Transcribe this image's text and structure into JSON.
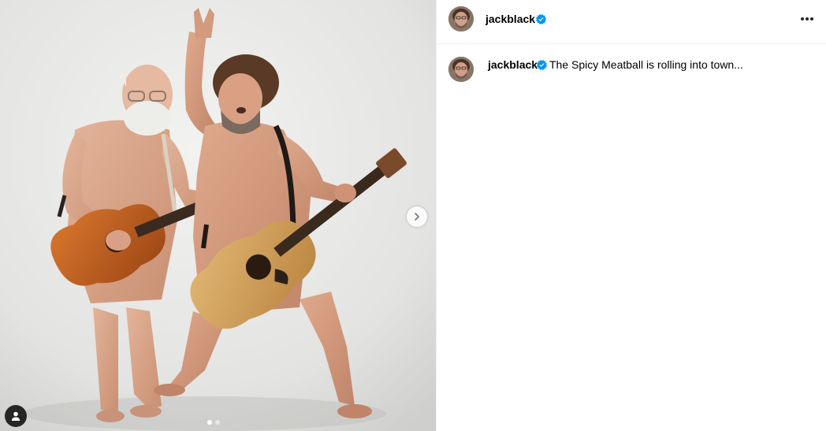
{
  "post": {
    "username": "jackblack",
    "caption": "The Spicy Meatball is rolling into town...",
    "carousel": {
      "total_slides": 2,
      "current_slide": 1
    }
  },
  "icons": {
    "verified": "verified-badge-icon",
    "more": "more-options-icon",
    "next": "chevron-right-icon",
    "tag": "user-tag-icon"
  },
  "colors": {
    "verified_blue": "#0095f6",
    "text_primary": "#000000",
    "divider": "#efefef",
    "tag_button_bg": "#262626"
  }
}
